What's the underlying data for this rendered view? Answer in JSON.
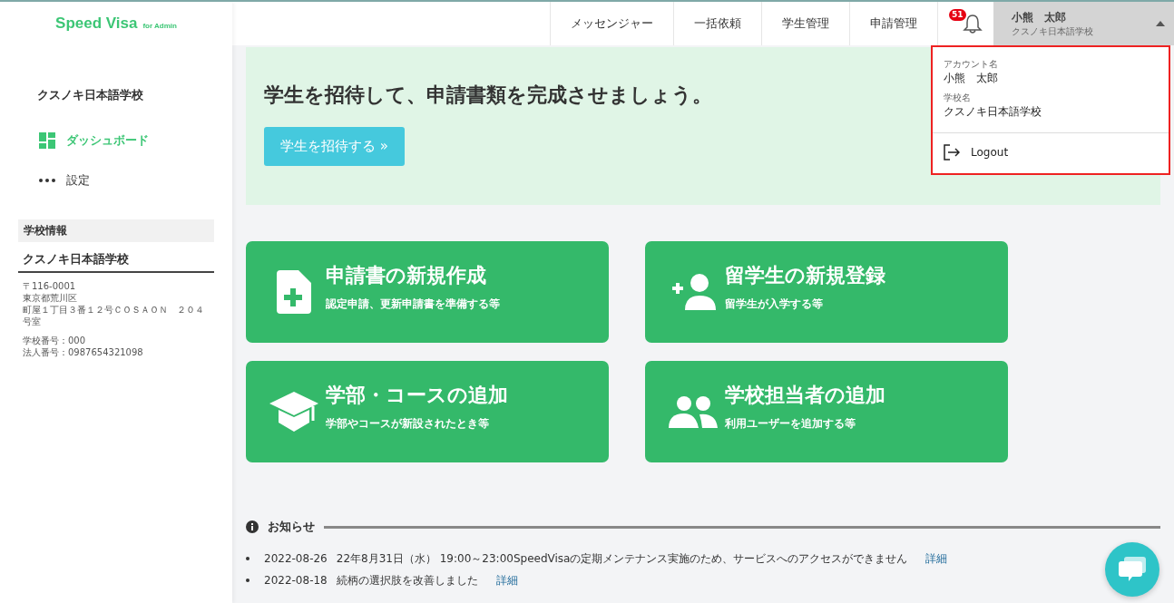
{
  "logo": {
    "name": "Speed Visa",
    "suffix": "for Admin"
  },
  "topnav": [
    {
      "label": "メッセンジャー",
      "selected": false
    },
    {
      "label": "一括依頼",
      "selected": false
    },
    {
      "label": "学生管理",
      "selected": false
    },
    {
      "label": "申請管理",
      "selected": false
    }
  ],
  "notifications": {
    "count": "51"
  },
  "user": {
    "name": "小熊　太郎",
    "school": "クスノキ日本語学校",
    "expanded": true
  },
  "dropdown": {
    "fields": [
      {
        "label": "アカウント名",
        "value": "小熊　太郎"
      },
      {
        "label": "学校名",
        "value": "クスノキ日本語学校"
      }
    ],
    "logout": "Logout"
  },
  "sidebar": {
    "school": "クスノキ日本語学校",
    "items": [
      {
        "kind": "dashboard",
        "label": "ダッシュボード",
        "selected": true
      },
      {
        "kind": "more",
        "label": "設定",
        "selected": false
      }
    ],
    "info": {
      "heading": "学校情報",
      "name": "クスノキ日本語学校",
      "address": [
        "〒116-0001",
        "東京都荒川区",
        "町屋１丁目３番１２号ＣＯＳＡＯＮ　２０４号室"
      ],
      "numbers": [
        "学校番号：000",
        "法人番号：0987654321098"
      ]
    }
  },
  "banner": {
    "title": "学生を招待して、申請書類を完成させましょう。",
    "button": "学生を招待する »"
  },
  "cards": [
    {
      "kind": "document",
      "title": "申請書の新規作成",
      "subtitle": "認定申請、更新申請書を準備する等"
    },
    {
      "kind": "add-user",
      "title": "留学生の新規登録",
      "subtitle": "留学生が入学する等"
    },
    {
      "kind": "graduation",
      "title": "学部・コースの追加",
      "subtitle": "学部やコースが新設されたとき等"
    },
    {
      "kind": "users",
      "title": "学校担当者の追加",
      "subtitle": "利用ユーザーを追加する等"
    }
  ],
  "notices": {
    "heading": "お知らせ",
    "items": [
      {
        "date": "2022-08-26",
        "text": "22年8月31日（水） 19:00～23:00SpeedVisaの定期メンテナンス実施のため、サービスへのアクセスができません",
        "link": "詳細"
      },
      {
        "date": "2022-08-18",
        "text": "続柄の選択肢を改善しました",
        "link": "詳細"
      }
    ]
  }
}
